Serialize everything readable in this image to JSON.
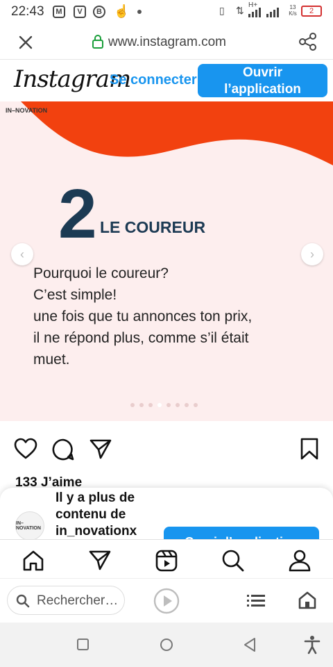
{
  "status_bar": {
    "time": "22:43",
    "app_icons": [
      "M",
      "V",
      "B"
    ],
    "network_speed": "13 K/s",
    "network_type": "H+",
    "battery_level": "2"
  },
  "browser": {
    "url": "www.instagram.com"
  },
  "instagram_header": {
    "logo": "Instagram",
    "connect_label": "Se connecter",
    "open_app_label_line1": "Ouvrir",
    "open_app_label_line2": "l’application"
  },
  "post": {
    "brand": "IN–NOVATION",
    "number": "2",
    "number_label": "LE COUREUR",
    "text_lines": [
      "Pourquoi le coureur?",
      "C’est simple!",
      "une fois que tu annonces ton prix,",
      "il ne répond plus, comme s’il était",
      "muet."
    ],
    "carousel_dot_count": 8,
    "carousel_active_index": 3,
    "likes": "133 J’aime"
  },
  "sheet": {
    "avatar_text": "IN–NOVATION",
    "line1": "Il y a plus de",
    "line2": "contenu de",
    "line3": "in_novationx",
    "open_app_label": "Ouvrir l’application"
  },
  "browser_bar": {
    "search_placeholder": "Rechercher…"
  },
  "colors": {
    "instagram_blue": "#1895ef",
    "post_orange": "#f2410f",
    "post_background": "#fdeeee",
    "headline_navy": "#1c3a53"
  }
}
